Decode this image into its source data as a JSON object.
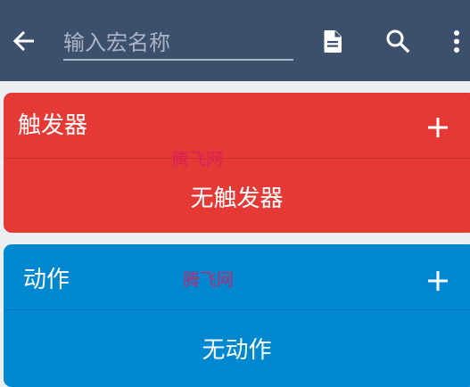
{
  "app_bar": {
    "name_placeholder": "输入宏名称",
    "name_value": "",
    "icons": {
      "back": "arrow-back-icon",
      "document": "document-icon",
      "search": "search-icon",
      "more": "more-vert-icon"
    },
    "background": "#3c4f6b"
  },
  "triggers": {
    "title": "触发器",
    "empty_text": "无触发器",
    "add_icon": "plus-icon",
    "color": "#e53935"
  },
  "actions": {
    "title": "动作",
    "empty_text": "无动作",
    "add_icon": "plus-icon",
    "color": "#0288d1"
  },
  "watermarks": [
    "腾飞网",
    "腾飞网"
  ]
}
